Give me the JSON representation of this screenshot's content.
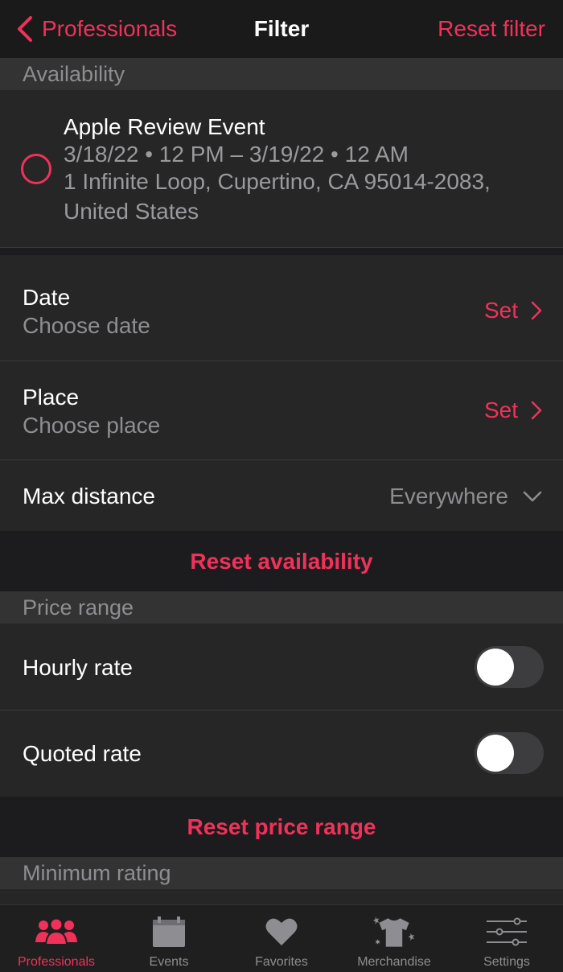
{
  "nav": {
    "back_label": "Professionals",
    "title": "Filter",
    "reset_label": "Reset filter"
  },
  "availability": {
    "header": "Availability",
    "event": {
      "title": "Apple Review Event",
      "datetime": "3/18/22 • 12 PM – 3/19/22 • 12 AM",
      "address_line1": "1 Infinite Loop, Cupertino, CA 95014-2083,",
      "address_line2": "United States"
    },
    "date": {
      "title": "Date",
      "subtitle": "Choose date",
      "action": "Set"
    },
    "place": {
      "title": "Place",
      "subtitle": "Choose place",
      "action": "Set"
    },
    "max_distance": {
      "title": "Max distance",
      "value": "Everywhere"
    },
    "reset_label": "Reset availability"
  },
  "price_range": {
    "header": "Price range",
    "hourly": {
      "title": "Hourly rate",
      "enabled": false
    },
    "quoted": {
      "title": "Quoted rate",
      "enabled": false
    },
    "reset_label": "Reset price range"
  },
  "minimum_rating": {
    "header": "Minimum rating"
  },
  "tabs": [
    {
      "label": "Professionals",
      "icon": "people-icon",
      "active": true
    },
    {
      "label": "Events",
      "icon": "calendar-icon",
      "active": false
    },
    {
      "label": "Favorites",
      "icon": "heart-icon",
      "active": false
    },
    {
      "label": "Merchandise",
      "icon": "shirt-icon",
      "active": false
    },
    {
      "label": "Settings",
      "icon": "sliders-icon",
      "active": false
    }
  ],
  "colors": {
    "accent": "#f0325a",
    "background": "#1c1c1e",
    "cell": "#262626",
    "section_header": "#333333",
    "secondary_text": "#8e8e92"
  }
}
